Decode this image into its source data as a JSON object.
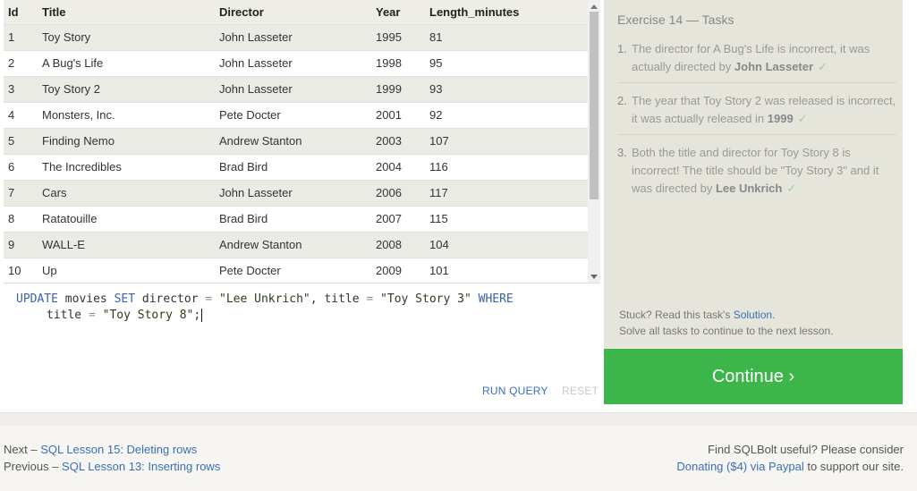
{
  "table": {
    "columns": [
      "Id",
      "Title",
      "Director",
      "Year",
      "Length_minutes"
    ],
    "rows": [
      [
        "1",
        "Toy Story",
        "John Lasseter",
        "1995",
        "81"
      ],
      [
        "2",
        "A Bug's Life",
        "John Lasseter",
        "1998",
        "95"
      ],
      [
        "3",
        "Toy Story 2",
        "John Lasseter",
        "1999",
        "93"
      ],
      [
        "4",
        "Monsters, Inc.",
        "Pete Docter",
        "2001",
        "92"
      ],
      [
        "5",
        "Finding Nemo",
        "Andrew Stanton",
        "2003",
        "107"
      ],
      [
        "6",
        "The Incredibles",
        "Brad Bird",
        "2004",
        "116"
      ],
      [
        "7",
        "Cars",
        "John Lasseter",
        "2006",
        "117"
      ],
      [
        "8",
        "Ratatouille",
        "Brad Bird",
        "2007",
        "115"
      ],
      [
        "9",
        "WALL-E",
        "Andrew Stanton",
        "2008",
        "104"
      ],
      [
        "10",
        "Up",
        "Pete Docter",
        "2009",
        "101"
      ]
    ]
  },
  "editor": {
    "tokens_line1": [
      {
        "t": "UPDATE",
        "c": "kw"
      },
      {
        "t": " movies ",
        "c": ""
      },
      {
        "t": "SET",
        "c": "kw"
      },
      {
        "t": " director ",
        "c": ""
      },
      {
        "t": "=",
        "c": "op"
      },
      {
        "t": " ",
        "c": ""
      },
      {
        "t": "\"Lee Unkrich\"",
        "c": "str"
      },
      {
        "t": ", title ",
        "c": ""
      },
      {
        "t": "=",
        "c": "op"
      },
      {
        "t": " ",
        "c": ""
      },
      {
        "t": "\"Toy Story 3\"",
        "c": "str"
      },
      {
        "t": " ",
        "c": ""
      },
      {
        "t": "WHERE",
        "c": "kw"
      }
    ],
    "tokens_line2": [
      {
        "t": "title ",
        "c": ""
      },
      {
        "t": "=",
        "c": "op"
      },
      {
        "t": " ",
        "c": ""
      },
      {
        "t": "\"Toy Story 8\"",
        "c": "str"
      },
      {
        "t": ";",
        "c": ""
      }
    ],
    "run_label": "RUN QUERY",
    "reset_label": "RESET"
  },
  "tasks": {
    "title": "Exercise 14 — Tasks",
    "items": [
      {
        "num": "1.",
        "text": "The director for A Bug's Life is incorrect, it was actually directed by ",
        "bold": "John Lasseter",
        "check": "✓"
      },
      {
        "num": "2.",
        "text": "The year that Toy Story 2 was released is incorrect, it was actually released in ",
        "bold": "1999",
        "check": "✓"
      },
      {
        "num": "3.",
        "text": "Both the title and director for Toy Story 8 is incorrect! The title should be \"Toy Story 3\" and it was directed by ",
        "bold": "Lee Unkrich",
        "check": "✓"
      }
    ],
    "stuck_prefix": "Stuck? Read this task's ",
    "solution_link": "Solution",
    "stuck_suffix": ".",
    "solve_all": "Solve all tasks to continue to the next lesson.",
    "continue_label": "Continue ›"
  },
  "footer": {
    "next_prefix": "Next – ",
    "next_link": "SQL Lesson 15: Deleting rows",
    "prev_prefix": "Previous – ",
    "prev_link": "SQL Lesson 13: Inserting rows",
    "useful": "Find SQLBolt useful? Please consider",
    "donate_link": "Donating ($4) via Paypal",
    "donate_suffix": " to support our site."
  },
  "colors": {
    "accent_link": "#3a6fb6",
    "continue_green": "#3cb54a",
    "task_panel": "#e6e5dc"
  }
}
